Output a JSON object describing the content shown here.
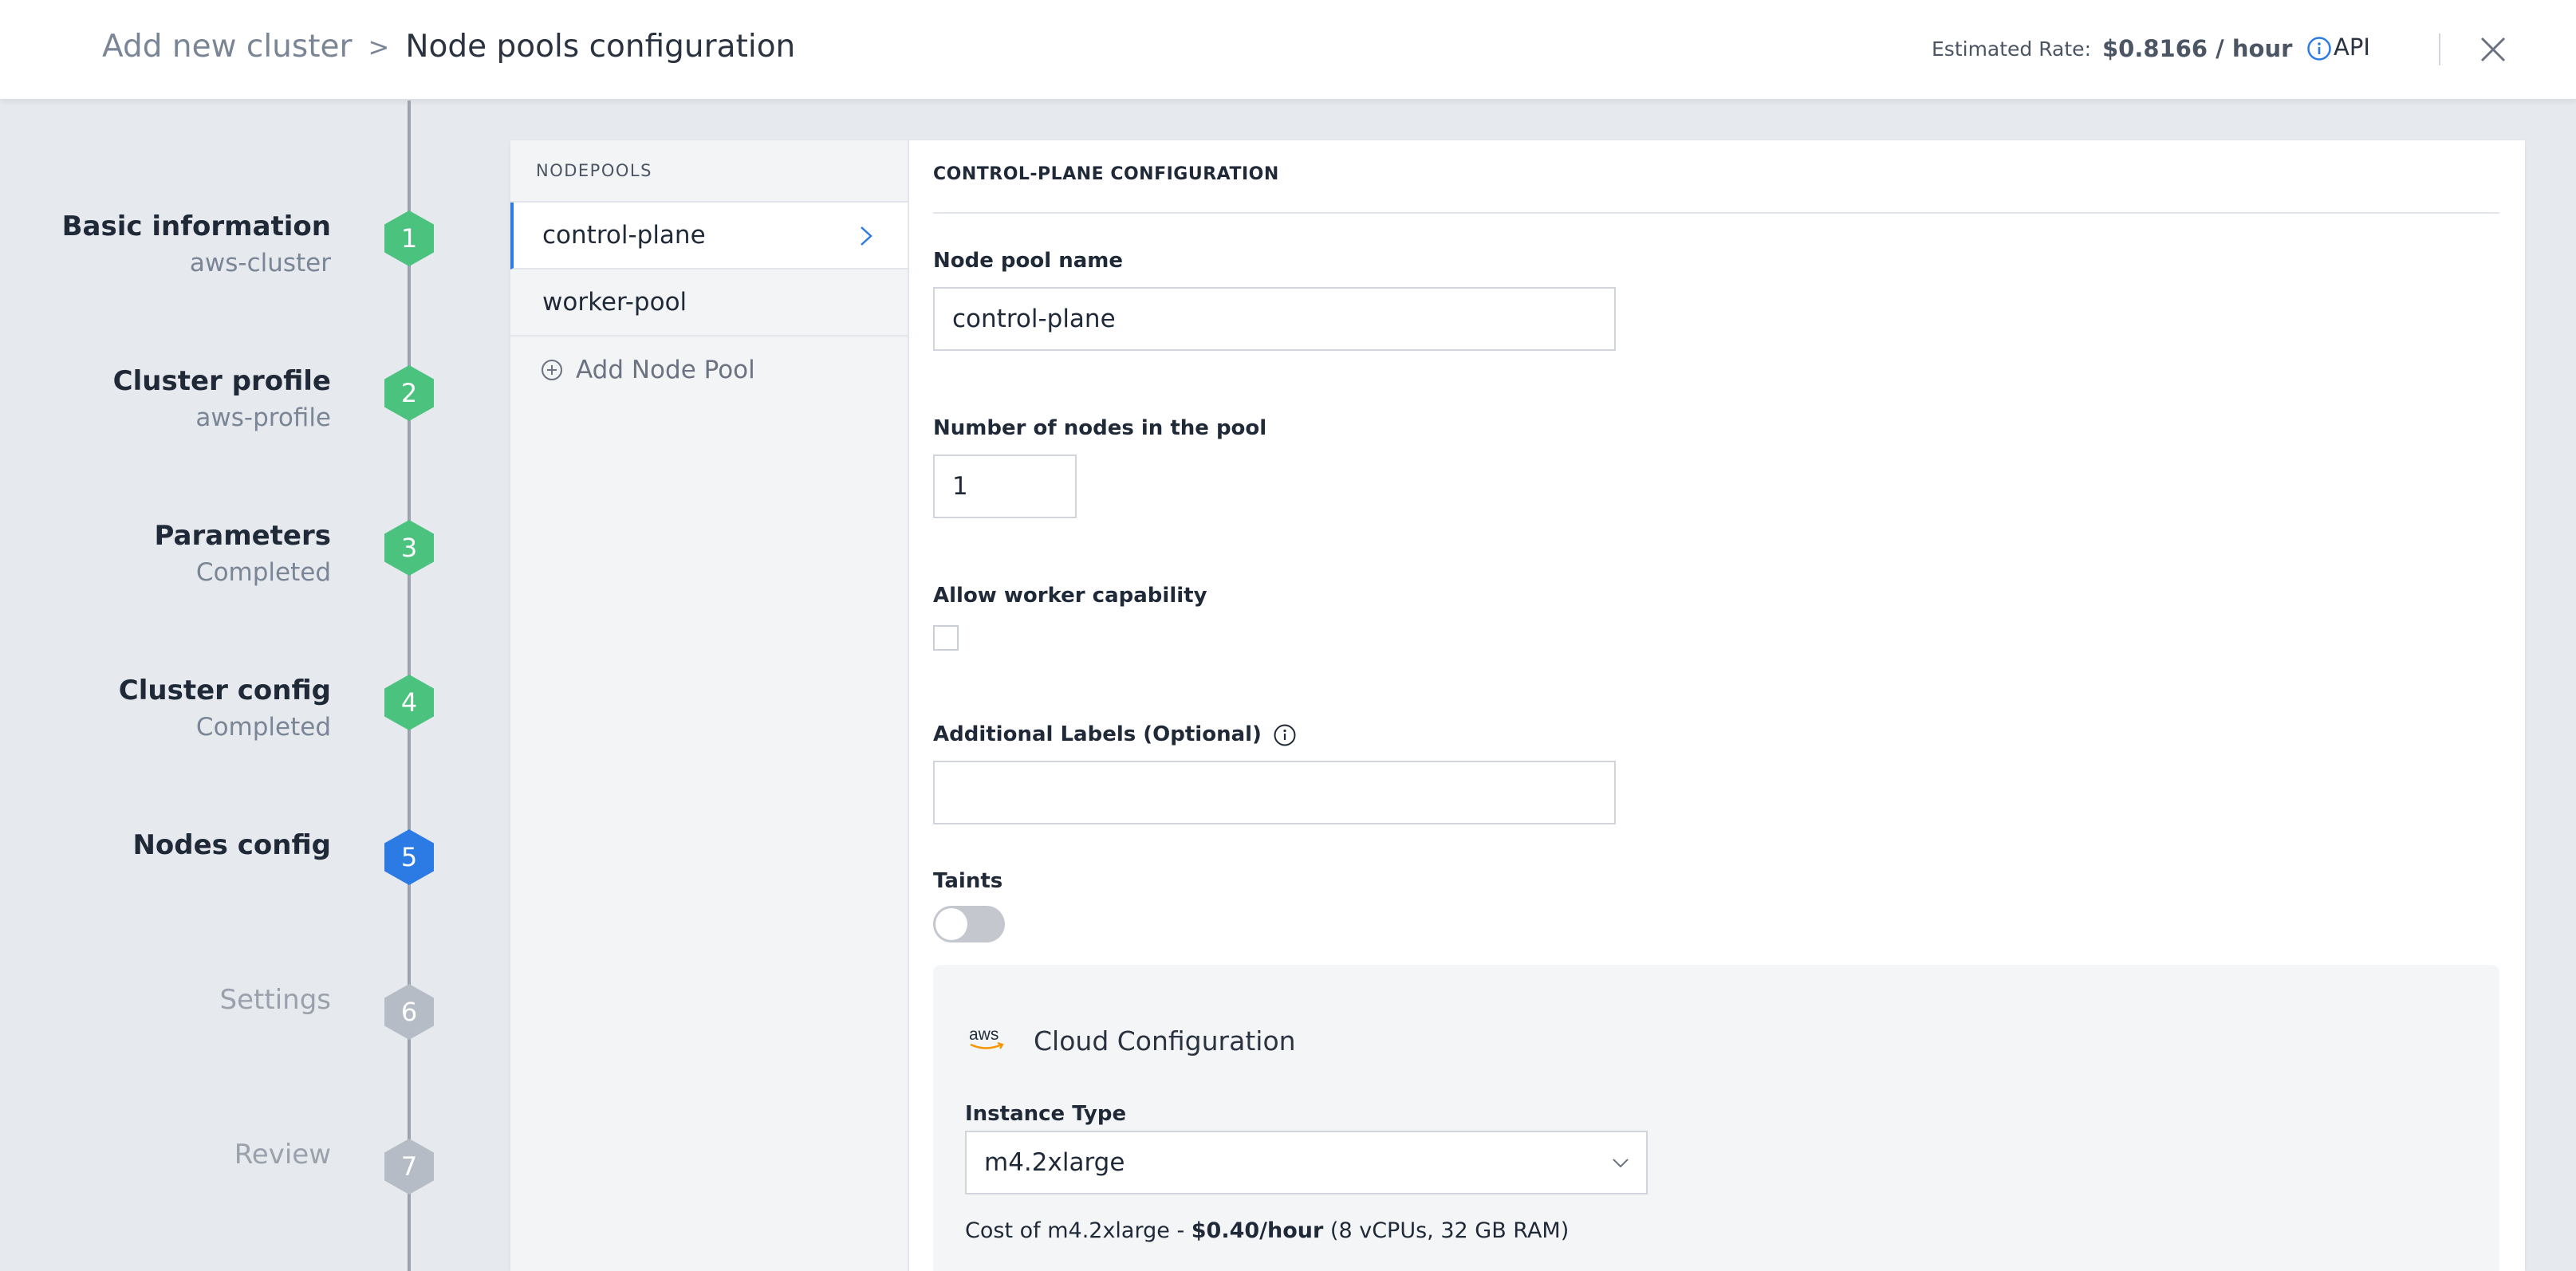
{
  "header": {
    "breadcrumb_parent": "Add new cluster",
    "breadcrumb_separator": ">",
    "breadcrumb_current": "Node pools configuration",
    "rate_label": "Estimated Rate:",
    "rate_value": "$0.8166 / hour",
    "api_label": "API"
  },
  "steps": [
    {
      "number": "1",
      "title": "Basic information",
      "subtitle": "aws-cluster",
      "state": "done"
    },
    {
      "number": "2",
      "title": "Cluster profile",
      "subtitle": "aws-profile",
      "state": "done"
    },
    {
      "number": "3",
      "title": "Parameters",
      "subtitle": "Completed",
      "state": "done"
    },
    {
      "number": "4",
      "title": "Cluster config",
      "subtitle": "Completed",
      "state": "done"
    },
    {
      "number": "5",
      "title": "Nodes config",
      "subtitle": "",
      "state": "active"
    },
    {
      "number": "6",
      "title": "Settings",
      "subtitle": "",
      "state": "future"
    },
    {
      "number": "7",
      "title": "Review",
      "subtitle": "",
      "state": "future"
    }
  ],
  "nodepools": {
    "header": "NODEPOOLS",
    "items": [
      {
        "label": "control-plane",
        "active": true
      },
      {
        "label": "worker-pool",
        "active": false
      }
    ],
    "add_label": "Add Node Pool"
  },
  "config": {
    "title": "CONTROL-PLANE CONFIGURATION",
    "pool_name_label": "Node pool name",
    "pool_name_value": "control-plane",
    "node_count_label": "Number of nodes in the pool",
    "node_count_value": "1",
    "worker_capability_label": "Allow worker capability",
    "worker_capability_checked": false,
    "labels_label": "Additional Labels (Optional)",
    "labels_value": "",
    "taints_label": "Taints",
    "taints_enabled": false
  },
  "cloud": {
    "logo_text": "aws",
    "title": "Cloud Configuration",
    "instance_type_label": "Instance Type",
    "instance_type_value": "m4.2xlarge",
    "cost_prefix": "Cost of m4.2xlarge - ",
    "cost_value": "$0.40/hour",
    "cost_suffix": " (8 vCPUs, 32 GB RAM)"
  },
  "colors": {
    "accent": "#2C7BE5",
    "done": "#4CC27F",
    "future": "#B6BCC5",
    "aws_orange": "#F79400"
  }
}
